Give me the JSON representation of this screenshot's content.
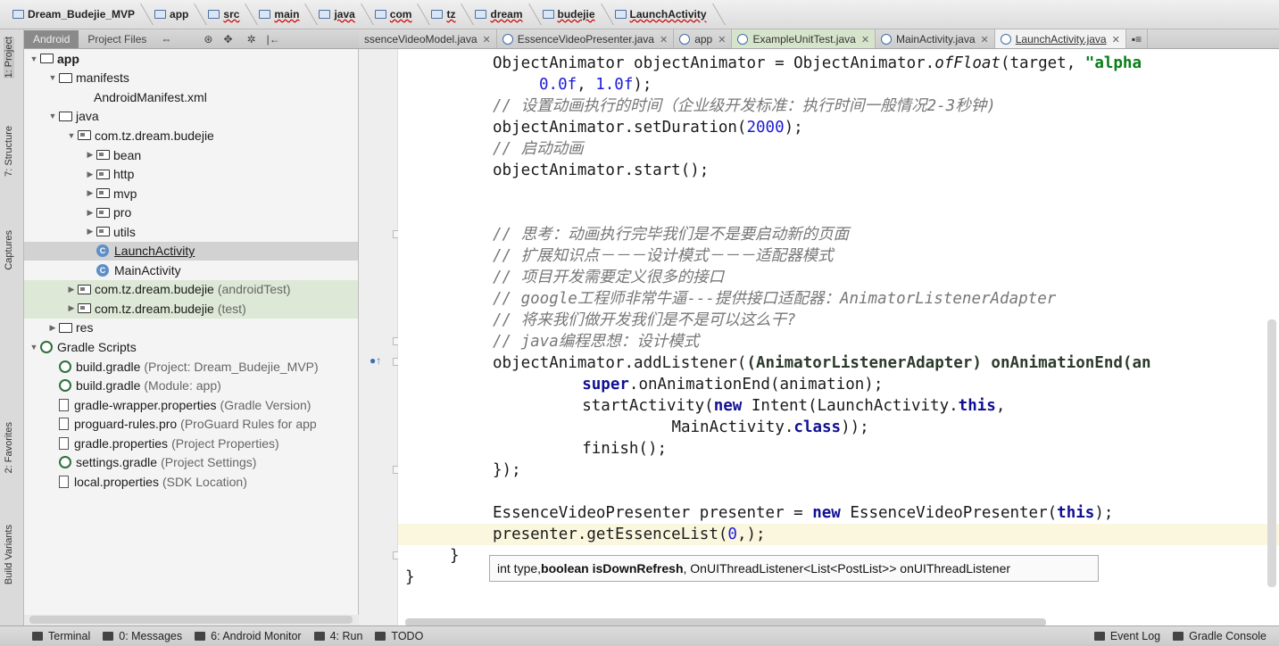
{
  "breadcrumbs": [
    "Dream_Budejie_MVP",
    "app",
    "src",
    "main",
    "java",
    "com",
    "tz",
    "dream",
    "budejie",
    "LaunchActivity"
  ],
  "project_panel": {
    "tabs": [
      "Android",
      "Project Files"
    ],
    "tree": [
      {
        "label": "app",
        "level": 0,
        "type": "module",
        "expanded": true
      },
      {
        "label": "manifests",
        "level": 1,
        "type": "folder",
        "expanded": true
      },
      {
        "label": "AndroidManifest.xml",
        "level": 2,
        "type": "xml"
      },
      {
        "label": "java",
        "level": 1,
        "type": "folder",
        "expanded": true
      },
      {
        "label": "com.tz.dream.budejie",
        "level": 2,
        "type": "package",
        "expanded": true
      },
      {
        "label": "bean",
        "level": 3,
        "type": "package",
        "expanded": false
      },
      {
        "label": "http",
        "level": 3,
        "type": "package",
        "expanded": false
      },
      {
        "label": "mvp",
        "level": 3,
        "type": "package",
        "expanded": false
      },
      {
        "label": "pro",
        "level": 3,
        "type": "package",
        "expanded": false
      },
      {
        "label": "utils",
        "level": 3,
        "type": "package",
        "expanded": false
      },
      {
        "label": "LaunchActivity",
        "level": 3,
        "type": "class",
        "selected": true
      },
      {
        "label": "MainActivity",
        "level": 3,
        "type": "class"
      },
      {
        "label": "com.tz.dream.budejie",
        "suffix": "(androidTest)",
        "level": 2,
        "type": "package",
        "expanded": false,
        "green": true
      },
      {
        "label": "com.tz.dream.budejie",
        "suffix": "(test)",
        "level": 2,
        "type": "package",
        "expanded": false,
        "green": true
      },
      {
        "label": "res",
        "level": 1,
        "type": "res",
        "expanded": false
      },
      {
        "label": "Gradle Scripts",
        "level": 0,
        "type": "gradle",
        "expanded": true
      },
      {
        "label": "build.gradle",
        "suffix": "(Project: Dream_Budejie_MVP)",
        "level": 1,
        "type": "gradle"
      },
      {
        "label": "build.gradle",
        "suffix": "(Module: app)",
        "level": 1,
        "type": "gradle"
      },
      {
        "label": "gradle-wrapper.properties",
        "suffix": "(Gradle Version)",
        "level": 1,
        "type": "doc"
      },
      {
        "label": "proguard-rules.pro",
        "suffix": "(ProGuard Rules for app",
        "level": 1,
        "type": "doc"
      },
      {
        "label": "gradle.properties",
        "suffix": "(Project Properties)",
        "level": 1,
        "type": "doc"
      },
      {
        "label": "settings.gradle",
        "suffix": "(Project Settings)",
        "level": 1,
        "type": "gradle"
      },
      {
        "label": "local.properties",
        "suffix": "(SDK Location)",
        "level": 1,
        "type": "doc"
      }
    ]
  },
  "left_tool_tabs": [
    "1: Project",
    "7: Structure",
    "Captures",
    "2: Favorites",
    "Build Variants"
  ],
  "editor_tabs": [
    {
      "label": "ssenceVideoModel.java",
      "type": "class"
    },
    {
      "label": "EssenceVideoPresenter.java",
      "type": "class"
    },
    {
      "label": "app",
      "type": "module"
    },
    {
      "label": "ExampleUnitTest.java",
      "type": "test"
    },
    {
      "label": "MainActivity.java",
      "type": "class"
    },
    {
      "label": "LaunchActivity.java",
      "type": "class",
      "active": true
    }
  ],
  "code_lines": [
    {
      "indent": 0,
      "parts": [
        [
          "ObjectAnimator objectAnimator = ObjectAnimator.",
          ""
        ],
        [
          "ofFloat",
          "it"
        ],
        [
          "(target, ",
          ""
        ],
        [
          "\"alpha",
          ""
        ]
      ]
    },
    {
      "indent": 1,
      "parts": [
        [
          "0.0f",
          "num"
        ],
        [
          ", ",
          ""
        ],
        [
          "1.0f",
          "num"
        ],
        [
          ");",
          ""
        ]
      ]
    },
    {
      "indent": 0,
      "parts": [
        [
          "// 设置动画执行的时间（企业级开发标准：执行时间一般情况",
          "cm"
        ],
        [
          "2-3",
          "cm"
        ],
        [
          "秒钟)",
          "cm"
        ]
      ]
    },
    {
      "indent": 0,
      "parts": [
        [
          "objectAnimator.setDuration(",
          ""
        ],
        [
          "2000",
          "num"
        ],
        [
          ");",
          ""
        ]
      ]
    },
    {
      "indent": 0,
      "parts": [
        [
          "// 启动动画",
          "cm"
        ]
      ]
    },
    {
      "indent": 0,
      "parts": [
        [
          "objectAnimator.start();",
          ""
        ]
      ]
    },
    {
      "indent": 0,
      "parts": []
    },
    {
      "indent": 0,
      "parts": []
    },
    {
      "indent": 0,
      "parts": [
        [
          "// 思考：动画执行完毕我们是不是要启动新的页面",
          "cm"
        ]
      ]
    },
    {
      "indent": 0,
      "parts": [
        [
          "// 扩展知识点－－－设计模式－－－适配器模式",
          "cm"
        ]
      ]
    },
    {
      "indent": 0,
      "parts": [
        [
          "// 项目开发需要定义很多的接口",
          "cm"
        ]
      ]
    },
    {
      "indent": 0,
      "parts": [
        [
          "// google",
          "cm"
        ],
        [
          "工程师非常牛逼---提供接口适配器：",
          "cm"
        ],
        [
          "AnimatorListenerAdapter",
          "cm"
        ]
      ]
    },
    {
      "indent": 0,
      "parts": [
        [
          "// 将来我们做开发我们是不是可以这么干?",
          "cm"
        ]
      ]
    },
    {
      "indent": 0,
      "parts": [
        [
          "// java",
          "cm"
        ],
        [
          "编程思想：设计模式",
          "cm"
        ]
      ]
    },
    {
      "indent": 0,
      "parts": [
        [
          "objectAnimator.addListener(",
          ""
        ],
        [
          "(AnimatorListenerAdapter) onAnimationEnd(an",
          "kw2"
        ]
      ]
    },
    {
      "indent": 2,
      "parts": [
        [
          "super",
          "kw"
        ],
        [
          ".onAnimationEnd(animation);",
          ""
        ]
      ]
    },
    {
      "indent": 2,
      "parts": [
        [
          "startActivity(",
          ""
        ],
        [
          "new",
          "kw"
        ],
        [
          " Intent(LaunchActivity.",
          ""
        ],
        [
          "this",
          "kw"
        ],
        [
          ",",
          ""
        ]
      ]
    },
    {
      "indent": 4,
      "parts": [
        [
          "MainActivity.",
          ""
        ],
        [
          "class",
          "kw"
        ],
        [
          "));",
          ""
        ]
      ]
    },
    {
      "indent": 2,
      "parts": [
        [
          "finish();",
          ""
        ]
      ]
    },
    {
      "indent": 0,
      "parts": [
        [
          "});",
          ""
        ]
      ]
    },
    {
      "indent": 0,
      "parts": []
    },
    {
      "indent": 0,
      "parts": [
        [
          "EssenceVideoPresenter presenter = ",
          ""
        ],
        [
          "new",
          "kw"
        ],
        [
          " EssenceVideoPresenter(",
          ""
        ],
        [
          "this",
          "kw"
        ],
        [
          ");",
          ""
        ]
      ]
    },
    {
      "indent": 0,
      "parts": [
        [
          "presenter.getEssenceList(",
          ""
        ],
        [
          "0",
          "num"
        ],
        [
          ",);",
          ""
        ]
      ]
    },
    {
      "indent": -1,
      "parts": [
        [
          "}",
          ""
        ]
      ]
    },
    {
      "indent": -2,
      "parts": [
        [
          "}",
          ""
        ]
      ]
    }
  ],
  "tooltip": {
    "before": "int type, ",
    "bold": "boolean isDownRefresh",
    "after": ", OnUIThreadListener<List<PostList>> onUIThreadListener"
  },
  "status_bar": {
    "left": [
      "Terminal",
      "0: Messages",
      "6: Android Monitor",
      "4: Run",
      "TODO"
    ],
    "right": [
      "Event Log",
      "Gradle Console"
    ]
  }
}
